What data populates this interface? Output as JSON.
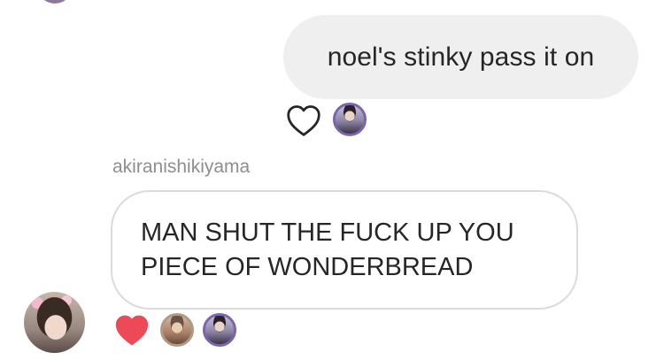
{
  "conversation": {
    "sent_message": {
      "text": "noel's stinky pass it on",
      "reactions": [
        {
          "type": "like",
          "liked": false,
          "icon": "heart-outline-icon"
        }
      ],
      "seen_by_count": 1
    },
    "received_message": {
      "sender": "akiranishikiyama",
      "lines": [
        "MAN SHUT THE FUCK UP YOU",
        "PIECE OF WONDERBREAD"
      ],
      "reactions": [
        {
          "type": "like",
          "liked": true,
          "icon": "heart-filled-icon",
          "color": "#ed4956"
        }
      ],
      "reactor_count": 2
    }
  },
  "colors": {
    "sent_bubble": "#efefef",
    "received_bubble_border": "#dbdbdb",
    "text": "#262626",
    "username": "#8e8e8e",
    "like": "#ed4956"
  }
}
